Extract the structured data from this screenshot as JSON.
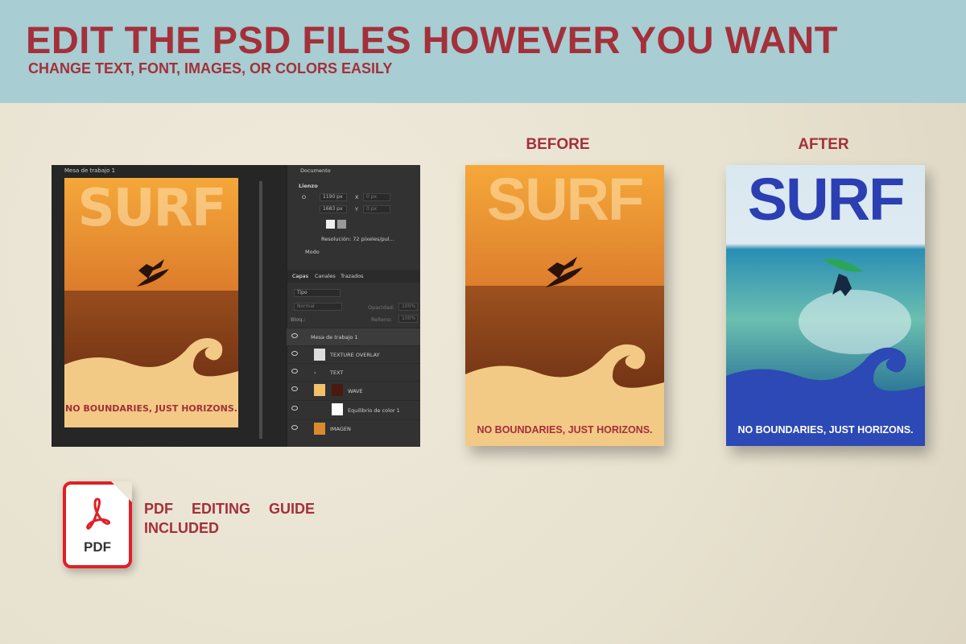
{
  "header": {
    "title": "EDIT THE PSD FILES HOWEVER YOU WANT",
    "subtitle": "CHANGE TEXT, FONT, IMAGES, OR COLORS EASILY"
  },
  "labels": {
    "before": "BEFORE",
    "after": "AFTER"
  },
  "poster": {
    "title": "SURF",
    "tagline": "NO BOUNDARIES, JUST HORIZONS."
  },
  "photoshop": {
    "tab_name": "Mesa de trabajo 1",
    "properties": {
      "documento": "Documento",
      "lienzo": "Lienzo",
      "width_label": "O",
      "width": "1190 px",
      "height": "1683 px",
      "x_label": "X",
      "x_value": "0 px",
      "y_label": "Y",
      "y_value": "0 px",
      "resolution": "Resolución: 72 píxeles/pul...",
      "modo": "Modo"
    },
    "tabs": [
      "Capas",
      "Canales",
      "Trazados"
    ],
    "filter": "Tipo",
    "blend_mode": "Normal",
    "opacity_label": "Opacidad:",
    "opacity": "100%",
    "lock_label": "Bloq.:",
    "fill_label": "Relleno:",
    "fill": "100%",
    "layers": [
      {
        "name": "Mesa de trabajo 1"
      },
      {
        "name": "TEXTURE OVERLAY"
      },
      {
        "name": "TEXT"
      },
      {
        "name": "WAVE"
      },
      {
        "name": "Equilibrio de color 1"
      },
      {
        "name": "IMAGEN"
      }
    ]
  },
  "pdf": {
    "icon_label": "PDF",
    "guide_line1": "PDF EDITING GUIDE",
    "guide_line2": "INCLUDED"
  },
  "colors": {
    "accent": "#a3303a",
    "banner": "#a8cdd2",
    "wall": "#ebe6d6",
    "before_sky": "#f0a53a",
    "before_wave": "#f2c98a",
    "after_title": "#2b3fb3",
    "after_wave": "#2c49b5",
    "pdf_red": "#e01f26"
  }
}
